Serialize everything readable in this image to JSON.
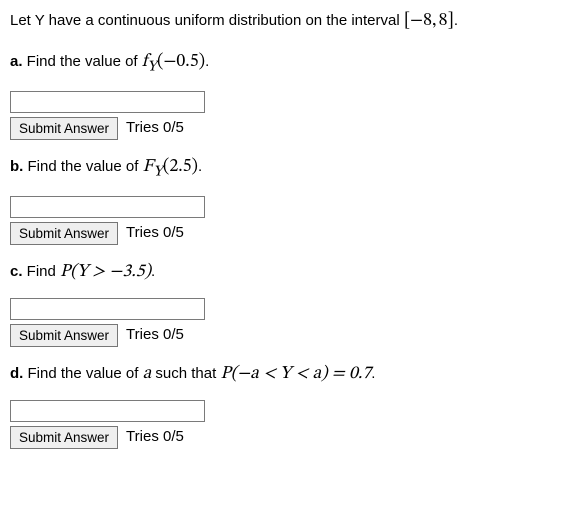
{
  "intro": {
    "prefix": "Let Y have a continuous uniform distribution on the interval ",
    "interval": "[−8, 8]",
    "suffix": "."
  },
  "parts": {
    "a": {
      "label": "a.",
      "text_before": " Find the value of ",
      "expr": "f",
      "sub": "Y",
      "arg": "(−0.5)",
      "text_after": ".",
      "submit": "Submit Answer",
      "tries": "Tries 0/5"
    },
    "b": {
      "label": "b.",
      "text_before": " Find the value of ",
      "expr": "F",
      "sub": "Y",
      "arg": "(2.5)",
      "text_after": ".",
      "submit": "Submit Answer",
      "tries": "Tries 0/5"
    },
    "c": {
      "label": "c.",
      "text_before": " Find ",
      "expr": "P(Y > −3.5)",
      "text_after": ".",
      "submit": "Submit Answer",
      "tries": "Tries 0/5"
    },
    "d": {
      "label": "d.",
      "text_before": " Find the value of ",
      "var": "a",
      "text_mid": " such that ",
      "expr": "P(−a < Y < a) = 0.7",
      "text_after": ".",
      "submit": "Submit Answer",
      "tries": "Tries 0/5"
    }
  }
}
